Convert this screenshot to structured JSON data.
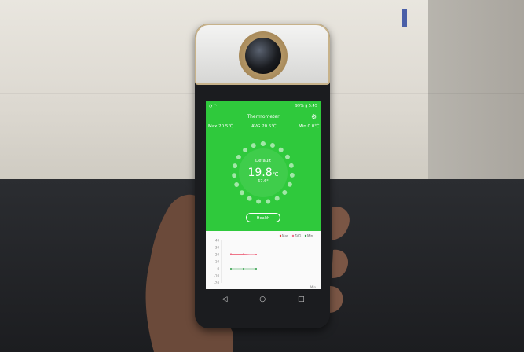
{
  "status_bar": {
    "time": "5:45",
    "battery": "99%"
  },
  "app": {
    "title": "Thermometer"
  },
  "stats": {
    "max_label": "Max",
    "max_value": "20.5℃",
    "avg_label": "AVG",
    "avg_value": "20.5℃",
    "min_label": "Min",
    "min_value": "0.0℃"
  },
  "dial": {
    "label": "Default",
    "temperature": "19.8",
    "unit": "℃",
    "fahrenheit": "67.6°"
  },
  "button": {
    "health_label": "Health"
  },
  "chart_data": {
    "type": "line",
    "legend": [
      "Max",
      "AVG",
      "Min"
    ],
    "y_ticks": [
      "40",
      "30",
      "20",
      "10",
      "0",
      "-10",
      "-20"
    ],
    "x_label": "Min",
    "series": [
      {
        "name": "Max",
        "values": [
          20.5,
          20.5,
          20
        ]
      },
      {
        "name": "AVG",
        "values": [
          20.5,
          20.5,
          20
        ]
      },
      {
        "name": "Min",
        "values": [
          0,
          0,
          0
        ]
      }
    ],
    "colors": {
      "Max": "#e53935",
      "AVG": "#ef6c8a",
      "Min": "#2e9e46"
    }
  },
  "nav": {
    "back_icon": "back-triangle-icon",
    "home_icon": "home-circle-icon",
    "recents_icon": "recents-square-icon"
  }
}
